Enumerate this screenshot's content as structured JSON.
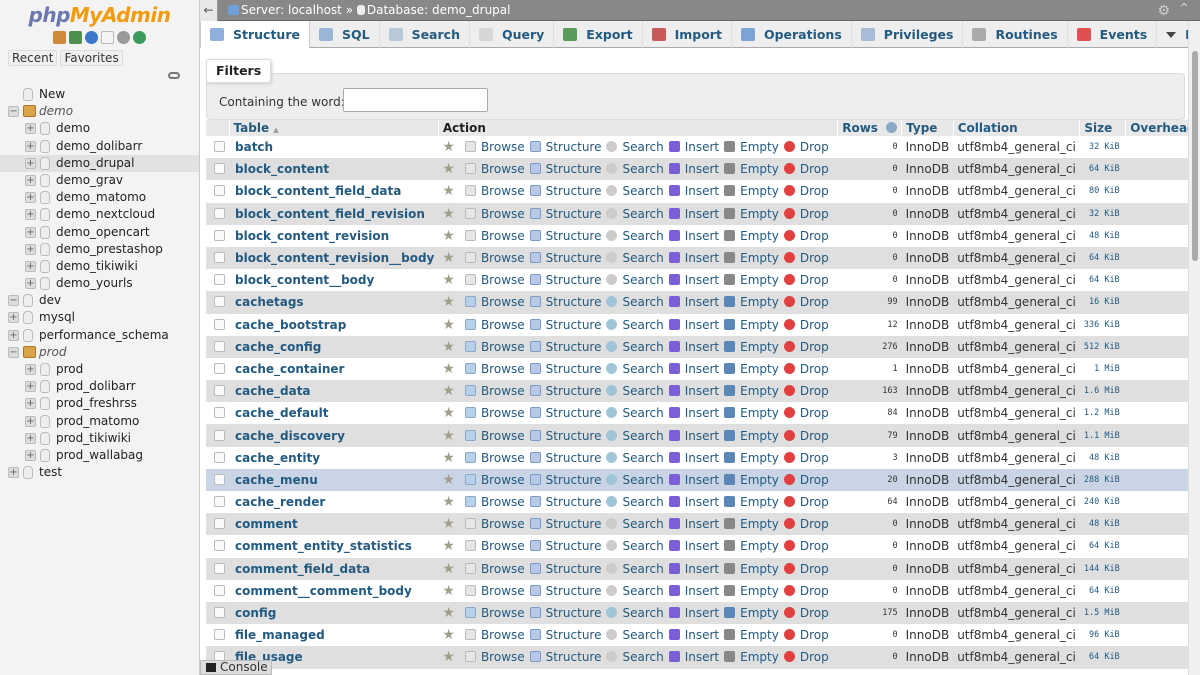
{
  "app": {
    "logo_php": "php",
    "logo_myadmin": "MyAdmin"
  },
  "sidebar": {
    "nav_icons": [
      "home-icon",
      "logout-icon",
      "help-icon",
      "docs-icon",
      "settings-icon",
      "reload-icon"
    ],
    "recent_label": "Recent",
    "favorites_label": "Favorites",
    "tree": [
      {
        "label": "New",
        "level": 0,
        "kind": "new"
      },
      {
        "label": "demo",
        "level": 0,
        "kind": "group",
        "expanded": true
      },
      {
        "label": "demo",
        "level": 1,
        "kind": "db"
      },
      {
        "label": "demo_dolibarr",
        "level": 1,
        "kind": "db"
      },
      {
        "label": "demo_drupal",
        "level": 1,
        "kind": "db",
        "selected": true
      },
      {
        "label": "demo_grav",
        "level": 1,
        "kind": "db"
      },
      {
        "label": "demo_matomo",
        "level": 1,
        "kind": "db"
      },
      {
        "label": "demo_nextcloud",
        "level": 1,
        "kind": "db"
      },
      {
        "label": "demo_opencart",
        "level": 1,
        "kind": "db"
      },
      {
        "label": "demo_prestashop",
        "level": 1,
        "kind": "db"
      },
      {
        "label": "demo_tikiwiki",
        "level": 1,
        "kind": "db"
      },
      {
        "label": "demo_yourls",
        "level": 1,
        "kind": "db"
      },
      {
        "label": "dev",
        "level": 0,
        "kind": "db",
        "expanded": true
      },
      {
        "label": "mysql",
        "level": 0,
        "kind": "db"
      },
      {
        "label": "performance_schema",
        "level": 0,
        "kind": "db"
      },
      {
        "label": "prod",
        "level": 0,
        "kind": "group",
        "expanded": true
      },
      {
        "label": "prod",
        "level": 1,
        "kind": "db"
      },
      {
        "label": "prod_dolibarr",
        "level": 1,
        "kind": "db"
      },
      {
        "label": "prod_freshrss",
        "level": 1,
        "kind": "db"
      },
      {
        "label": "prod_matomo",
        "level": 1,
        "kind": "db"
      },
      {
        "label": "prod_tikiwiki",
        "level": 1,
        "kind": "db"
      },
      {
        "label": "prod_wallabag",
        "level": 1,
        "kind": "db"
      },
      {
        "label": "test",
        "level": 0,
        "kind": "db"
      }
    ]
  },
  "topbar": {
    "back_glyph": "←",
    "server_label": "Server: localhost",
    "separator": "»",
    "database_label": "Database: demo_drupal"
  },
  "tabs": [
    {
      "label": "Structure",
      "icon": "structure-icon",
      "color": "#8fb0dc",
      "active": true
    },
    {
      "label": "SQL",
      "icon": "sql-icon",
      "color": "#9bb5d9"
    },
    {
      "label": "Search",
      "icon": "search-icon",
      "color": "#b8c8d8"
    },
    {
      "label": "Query",
      "icon": "query-icon",
      "color": "#d6d6d6"
    },
    {
      "label": "Export",
      "icon": "export-icon",
      "color": "#5a9a5a"
    },
    {
      "label": "Import",
      "icon": "import-icon",
      "color": "#c85a5a"
    },
    {
      "label": "Operations",
      "icon": "wrench-icon",
      "color": "#7ba3d4"
    },
    {
      "label": "Privileges",
      "icon": "privileges-icon",
      "color": "#a9bcd6"
    },
    {
      "label": "Routines",
      "icon": "routines-icon",
      "color": "#aaaaaa"
    },
    {
      "label": "Events",
      "icon": "clock-icon",
      "color": "#e05050"
    },
    {
      "label": "More",
      "icon": "caret-down-icon",
      "color": "#444444"
    }
  ],
  "filters": {
    "legend": "Filters",
    "label": "Containing the word:",
    "value": "",
    "placeholder": ""
  },
  "table": {
    "headers": {
      "table": "Table",
      "sort_glyph": "▲",
      "action": "Action",
      "rows": "Rows",
      "type": "Type",
      "collation": "Collation",
      "size": "Size",
      "overhead": "Overhead"
    },
    "actions": {
      "browse": "Browse",
      "structure": "Structure",
      "search": "Search",
      "insert": "Insert",
      "empty": "Empty",
      "drop": "Drop"
    },
    "rows": [
      {
        "name": "batch",
        "rows": "0",
        "type": "InnoDB",
        "collation": "utf8mb4_general_ci",
        "size": "32 KiB",
        "overhead": "-"
      },
      {
        "name": "block_content",
        "rows": "0",
        "type": "InnoDB",
        "collation": "utf8mb4_general_ci",
        "size": "64 KiB",
        "overhead": "-"
      },
      {
        "name": "block_content_field_data",
        "rows": "0",
        "type": "InnoDB",
        "collation": "utf8mb4_general_ci",
        "size": "80 KiB",
        "overhead": "-"
      },
      {
        "name": "block_content_field_revision",
        "rows": "0",
        "type": "InnoDB",
        "collation": "utf8mb4_general_ci",
        "size": "32 KiB",
        "overhead": "-"
      },
      {
        "name": "block_content_revision",
        "rows": "0",
        "type": "InnoDB",
        "collation": "utf8mb4_general_ci",
        "size": "48 KiB",
        "overhead": "-"
      },
      {
        "name": "block_content_revision__body",
        "rows": "0",
        "type": "InnoDB",
        "collation": "utf8mb4_general_ci",
        "size": "64 KiB",
        "overhead": "-"
      },
      {
        "name": "block_content__body",
        "rows": "0",
        "type": "InnoDB",
        "collation": "utf8mb4_general_ci",
        "size": "64 KiB",
        "overhead": "-"
      },
      {
        "name": "cachetags",
        "rows": "99",
        "type": "InnoDB",
        "collation": "utf8mb4_general_ci",
        "size": "16 KiB",
        "overhead": "-"
      },
      {
        "name": "cache_bootstrap",
        "rows": "12",
        "type": "InnoDB",
        "collation": "utf8mb4_general_ci",
        "size": "336 KiB",
        "overhead": "-"
      },
      {
        "name": "cache_config",
        "rows": "276",
        "type": "InnoDB",
        "collation": "utf8mb4_general_ci",
        "size": "512 KiB",
        "overhead": "-"
      },
      {
        "name": "cache_container",
        "rows": "1",
        "type": "InnoDB",
        "collation": "utf8mb4_general_ci",
        "size": "1 MiB",
        "overhead": "-"
      },
      {
        "name": "cache_data",
        "rows": "163",
        "type": "InnoDB",
        "collation": "utf8mb4_general_ci",
        "size": "1.6 MiB",
        "overhead": "-"
      },
      {
        "name": "cache_default",
        "rows": "84",
        "type": "InnoDB",
        "collation": "utf8mb4_general_ci",
        "size": "1.2 MiB",
        "overhead": "-"
      },
      {
        "name": "cache_discovery",
        "rows": "79",
        "type": "InnoDB",
        "collation": "utf8mb4_general_ci",
        "size": "1.1 MiB",
        "overhead": "-"
      },
      {
        "name": "cache_entity",
        "rows": "3",
        "type": "InnoDB",
        "collation": "utf8mb4_general_ci",
        "size": "48 KiB",
        "overhead": "-"
      },
      {
        "name": "cache_menu",
        "rows": "20",
        "type": "InnoDB",
        "collation": "utf8mb4_general_ci",
        "size": "288 KiB",
        "overhead": "-",
        "highlight": true
      },
      {
        "name": "cache_render",
        "rows": "64",
        "type": "InnoDB",
        "collation": "utf8mb4_general_ci",
        "size": "240 KiB",
        "overhead": "-"
      },
      {
        "name": "comment",
        "rows": "0",
        "type": "InnoDB",
        "collation": "utf8mb4_general_ci",
        "size": "48 KiB",
        "overhead": "-"
      },
      {
        "name": "comment_entity_statistics",
        "rows": "0",
        "type": "InnoDB",
        "collation": "utf8mb4_general_ci",
        "size": "64 KiB",
        "overhead": "-"
      },
      {
        "name": "comment_field_data",
        "rows": "0",
        "type": "InnoDB",
        "collation": "utf8mb4_general_ci",
        "size": "144 KiB",
        "overhead": "-"
      },
      {
        "name": "comment__comment_body",
        "rows": "0",
        "type": "InnoDB",
        "collation": "utf8mb4_general_ci",
        "size": "64 KiB",
        "overhead": "-"
      },
      {
        "name": "config",
        "rows": "175",
        "type": "InnoDB",
        "collation": "utf8mb4_general_ci",
        "size": "1.5 MiB",
        "overhead": "-"
      },
      {
        "name": "file_managed",
        "rows": "0",
        "type": "InnoDB",
        "collation": "utf8mb4_general_ci",
        "size": "96 KiB",
        "overhead": "-"
      },
      {
        "name": "file_usage",
        "rows": "0",
        "type": "InnoDB",
        "collation": "utf8mb4_general_ci",
        "size": "64 KiB",
        "overhead": "-"
      }
    ]
  },
  "console": {
    "label": "Console"
  }
}
